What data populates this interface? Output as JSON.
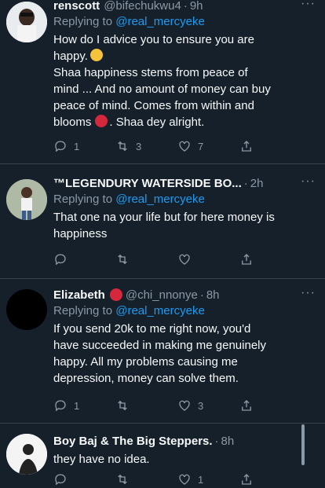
{
  "tweets": [
    {
      "name": "renscott",
      "handle": "@bifechukwu4",
      "time": "9h",
      "replying_prefix": "Replying to",
      "replying_to": "@real_mercyeke",
      "body_lines": [
        "How do I advice you to ensure you are",
        "happy.",
        "Shaa happiness stems from peace of",
        "mind ... And no amount of money can buy",
        "peace of mind. Comes from within and",
        "blooms",
        ". Shaa dey alright."
      ],
      "reply_count": "1",
      "retweet_count": "3",
      "like_count": "7"
    },
    {
      "name": "™LEGENDURY WATERSIDE BO...",
      "time": "2h",
      "replying_prefix": "Replying to",
      "replying_to": "@real_mercyeke",
      "body_lines": [
        "That one na your life but for here money is",
        "happiness"
      ]
    },
    {
      "name": "Elizabeth",
      "handle": "@chi_nnonye",
      "time": "8h",
      "replying_prefix": "Replying to",
      "replying_to": "@real_mercyeke",
      "body_lines": [
        "If you send 20k to me right now, you'd",
        "have succeeded in making me genuinely",
        "happy. All my problems causing me",
        "depression, money can solve them."
      ],
      "reply_count": "1",
      "like_count": "3"
    },
    {
      "name": "Boy Baj & The Big Steppers.",
      "time": "8h",
      "body": "they have no idea.",
      "like_count": "1"
    }
  ],
  "icons": [
    "reply-icon",
    "retweet-icon",
    "like-icon",
    "share-icon",
    "more-icon"
  ],
  "colors": {
    "background": "#15202b",
    "accent": "#1d9bf0",
    "muted": "#8b98a5",
    "divider": "#38444d"
  }
}
